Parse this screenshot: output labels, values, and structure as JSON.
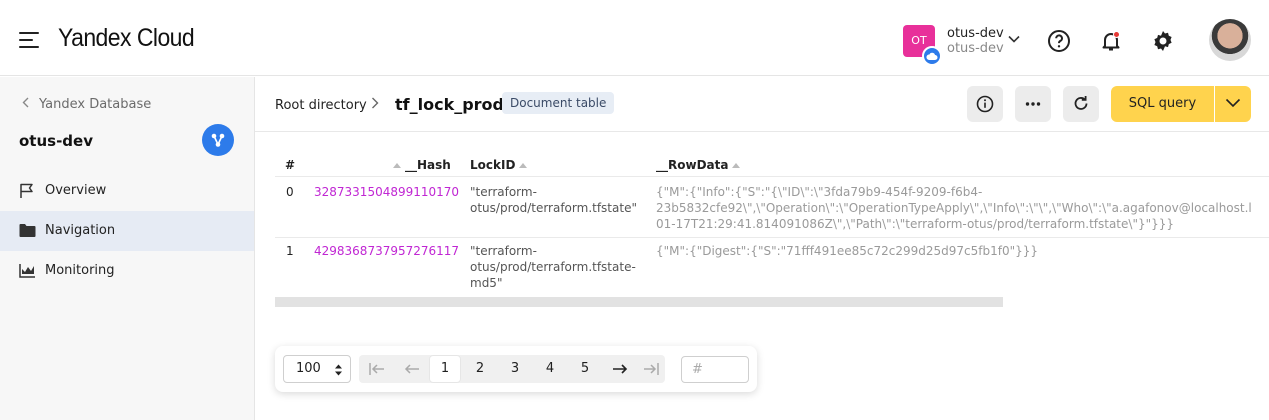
{
  "header": {
    "logo": "Yandex Cloud",
    "cloud_initials": "OT",
    "cloud_name": "otus-dev",
    "cloud_folder": "otus-dev",
    "accent_color": "#e8309a"
  },
  "sidebar": {
    "back_label": "Yandex Database",
    "title": "otus-dev",
    "items": [
      {
        "label": "Overview",
        "icon": "flag-icon",
        "active": false
      },
      {
        "label": "Navigation",
        "icon": "folder-icon",
        "active": true
      },
      {
        "label": "Monitoring",
        "icon": "chart-icon",
        "active": false
      }
    ]
  },
  "breadcrumb": {
    "root": "Root directory",
    "current": "tf_lock_prod",
    "badge": "Document table"
  },
  "toolbar": {
    "sql_label": "SQL query"
  },
  "table": {
    "columns": [
      "#",
      "__Hash",
      "LockID",
      "__RowData"
    ],
    "rows": [
      {
        "index": "0",
        "hash": "3287331504899110170",
        "lockid": "\"terraform-\notus/prod/terraform.tfstate\"",
        "rowdata": "{\"M\":{\"Info\":{\"S\":\"{\\\"ID\\\":\\\"3fda79b9-454f-9209-f6b4-\n23b5832cfe92\\\",\\\"Operation\\\":\\\"OperationTypeApply\\\",\\\"Info\\\":\\\"\\\",\\\"Who\\\":\\\"a.agafonov@localhost.l\n01-17T21:29:41.814091086Z\\\",\\\"Path\\\":\\\"terraform-otus/prod/terraform.tfstate\\\"}\"}}}"
      },
      {
        "index": "1",
        "hash": "4298368737957276117",
        "lockid": "\"terraform-\notus/prod/terraform.tfstate-\nmd5\"",
        "rowdata": "{\"M\":{\"Digest\":{\"S\":\"71fff491ee85c72c299d25d97c5fb1f0\"}}}"
      }
    ]
  },
  "pagination": {
    "page_size": "100",
    "pages": [
      "1",
      "2",
      "3",
      "4",
      "5"
    ],
    "current_page": "1",
    "page_input_placeholder": "#"
  }
}
